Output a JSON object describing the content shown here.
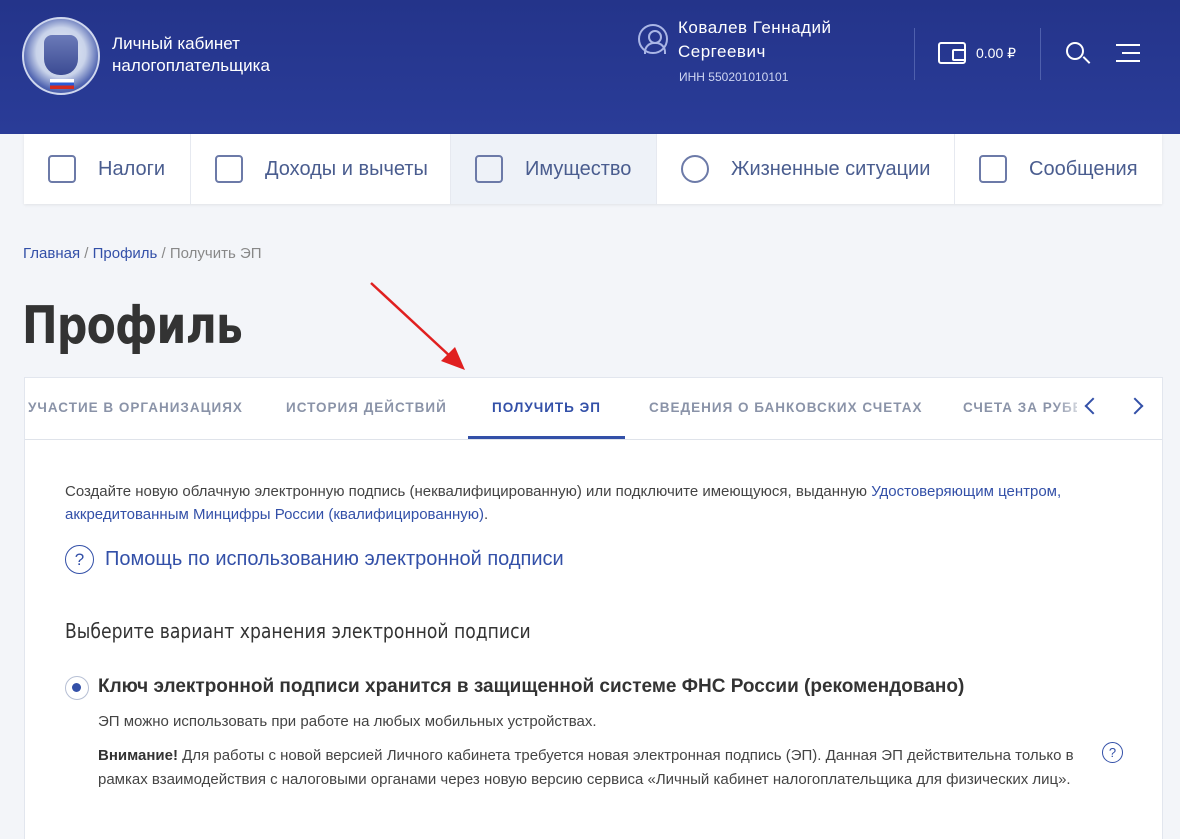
{
  "header": {
    "brand_line1": "Личный кабинет",
    "brand_line2": "налогоплательщика",
    "user_line1": "Ковалев Геннадий",
    "user_line2": "Сергеевич",
    "inn": "ИНН 550201010101",
    "balance": "0.00 ₽"
  },
  "nav": {
    "items": [
      {
        "label": "Налоги",
        "icon": "calculator-icon"
      },
      {
        "label": "Доходы и вычеты",
        "icon": "ruble-document-icon"
      },
      {
        "label": "Имущество",
        "icon": "house-icon"
      },
      {
        "label": "Жизненные ситуации",
        "icon": "person-ideas-icon"
      },
      {
        "label": "Сообщения",
        "icon": "envelope-icon"
      }
    ],
    "active_index": 2
  },
  "breadcrumb": {
    "home": "Главная",
    "sep1": " / ",
    "profile": "Профиль",
    "sep2": " / ",
    "current": "Получить ЭП"
  },
  "page_title": "Профиль",
  "tabs": [
    "УЧАСТИЕ В ОРГАНИЗАЦИЯХ",
    "ИСТОРИЯ ДЕЙСТВИЙ",
    "ПОЛУЧИТЬ ЭП",
    "СВЕДЕНИЯ О БАНКОВСКИХ СЧЕТАХ",
    "СЧЕТА ЗА РУБЕЖОМ"
  ],
  "active_tab": "ПОЛУЧИТЬ ЭП",
  "intro": {
    "text": "Создайте новую облачную электронную подпись (неквалифицированную) или подключите имеющуюся, выданную ",
    "link": "Удостоверяющим центром, аккредитованным Минцифры России (квалифицированную)",
    "end": "."
  },
  "help_link": "Помощь по использованию электронной подписи",
  "storage_heading": "Выберите вариант хранения электронной подписи",
  "option": {
    "title": "Ключ электронной подписи хранится в защищенной системе ФНС России (рекомендовано)",
    "description": "ЭП можно использовать при работе на любых мобильных устройствах.",
    "warning_label": "Внимание!",
    "warning_text": " Для работы с новой версией Личного кабинета требуется новая электронная подпись (ЭП). Данная ЭП  действительна только в рамках взаимодействия с налоговыми органами через новую версию сервиса  «Личный кабинет налогоплательщика для физических лиц»."
  },
  "colors": {
    "header_bg": "#2a3c98",
    "accent": "#3350a8",
    "annotation_arrow": "#e02020"
  }
}
